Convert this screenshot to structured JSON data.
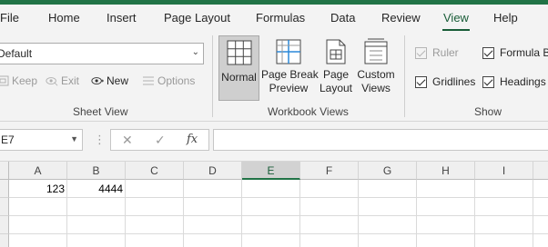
{
  "tabs": [
    "File",
    "Home",
    "Insert",
    "Page Layout",
    "Formulas",
    "Data",
    "Review",
    "View",
    "Help"
  ],
  "active_tab": "View",
  "sheet_view": {
    "selected_view": "Default",
    "buttons": [
      {
        "label": "Keep",
        "icon": "keep-icon",
        "enabled": false
      },
      {
        "label": "Exit",
        "icon": "exit-icon",
        "enabled": false
      },
      {
        "label": "New",
        "icon": "new-view-icon",
        "enabled": true
      },
      {
        "label": "Options",
        "icon": "options-icon",
        "enabled": false
      }
    ],
    "group_label": "Sheet View"
  },
  "workbook_views": {
    "buttons": [
      {
        "line1": "Normal",
        "line2": "",
        "icon": "normal-view-icon",
        "selected": true
      },
      {
        "line1": "Page Break",
        "line2": "Preview",
        "icon": "page-break-preview-icon",
        "selected": false
      },
      {
        "line1": "Page",
        "line2": "Layout",
        "icon": "page-layout-icon",
        "selected": false
      },
      {
        "line1": "Custom",
        "line2": "Views",
        "icon": "custom-views-icon",
        "selected": false
      }
    ],
    "group_label": "Workbook Views"
  },
  "show": {
    "items": [
      {
        "label": "Ruler",
        "checked": true,
        "enabled": false
      },
      {
        "label": "Formula B",
        "checked": true,
        "enabled": true
      },
      {
        "label": "Gridlines",
        "checked": true,
        "enabled": true
      },
      {
        "label": "Headings",
        "checked": true,
        "enabled": true
      }
    ],
    "group_label": "Show"
  },
  "formula_bar": {
    "name_box": "E7",
    "cancel_glyph": "✕",
    "enter_glyph": "✓",
    "fx_glyph": "fx",
    "formula_value": ""
  },
  "grid": {
    "columns": [
      "A",
      "B",
      "C",
      "D",
      "E",
      "F",
      "G",
      "H",
      "I"
    ],
    "selected_column": "E",
    "cells": [
      {
        "col": "A",
        "row": 1,
        "value": "123"
      },
      {
        "col": "B",
        "row": 1,
        "value": "4444"
      }
    ]
  },
  "colors": {
    "accent": "#217346",
    "accent_dark": "#185c37",
    "ribbon_bg": "#f3f3f3"
  }
}
